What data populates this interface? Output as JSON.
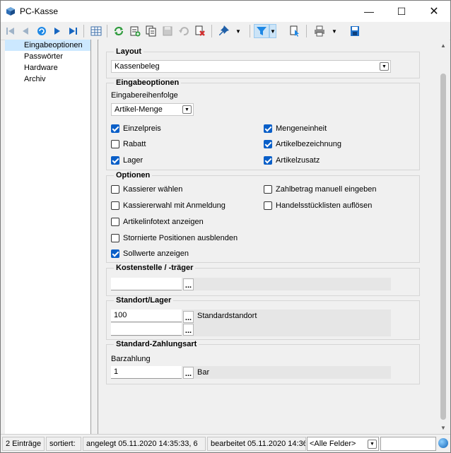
{
  "window": {
    "title": "PC-Kasse"
  },
  "nav": {
    "items": [
      "Eingabeoptionen",
      "Passwörter",
      "Hardware",
      "Archiv"
    ]
  },
  "layout_group": {
    "title": "Layout",
    "value": "Kassenbeleg"
  },
  "input_group": {
    "title": "Eingabeoptionen",
    "order_label": "Eingabereihenfolge",
    "order_value": "Artikel-Menge",
    "checks": [
      {
        "label": "Einzelpreis",
        "checked": true
      },
      {
        "label": "Mengeneinheit",
        "checked": true
      },
      {
        "label": "Rabatt",
        "checked": false
      },
      {
        "label": "Artikelbezeichnung",
        "checked": true
      },
      {
        "label": "Lager",
        "checked": true
      },
      {
        "label": "Artikelzusatz",
        "checked": true
      }
    ]
  },
  "options_group": {
    "title": "Optionen",
    "checks": [
      {
        "label": "Kassierer wählen",
        "checked": false
      },
      {
        "label": "Zahlbetrag manuell eingeben",
        "checked": false
      },
      {
        "label": "Kassiererwahl mit Anmeldung",
        "checked": false
      },
      {
        "label": "Handelsstücklisten auflösen",
        "checked": false
      },
      {
        "label": "Artikelinfotext anzeigen",
        "checked": false
      },
      {
        "label": "Stornierte Positionen ausblenden",
        "checked": false
      },
      {
        "label": "Sollwerte anzeigen",
        "checked": true
      }
    ]
  },
  "cost_group": {
    "title": "Kostenstelle / -träger",
    "browse": "..."
  },
  "location_group": {
    "title": "Standort/Lager",
    "location_value": "100",
    "location_name": "Standardstandort",
    "browse": "..."
  },
  "payment_group": {
    "title": "Standard-Zahlungsart",
    "label": "Barzahlung",
    "value": "1",
    "name": "Bar",
    "browse": "..."
  },
  "statusbar": {
    "count": "2 Einträge",
    "sorted": "sortiert:",
    "created": "angelegt 05.11.2020 14:35:33,  6",
    "edited": "bearbeitet 05.11.2020 14:36:",
    "filter_field": "<Alle Felder>"
  },
  "colors": {
    "accent": "#0a5fc8",
    "selection": "#cce8ff"
  }
}
